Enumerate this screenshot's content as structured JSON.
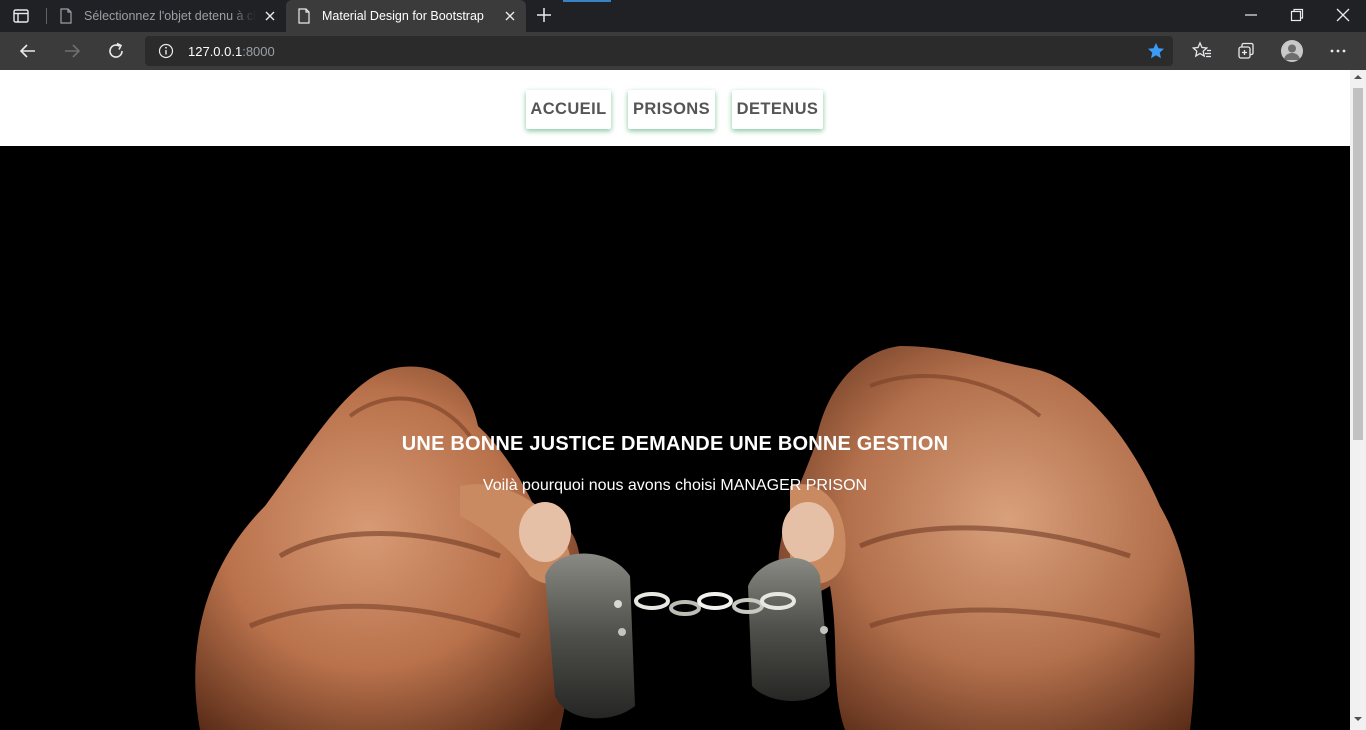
{
  "browser": {
    "tabs": [
      {
        "title": "Sélectionnez l'objet detenu à changer",
        "active": false
      },
      {
        "title": "Material Design for Bootstrap",
        "active": true
      }
    ],
    "url_host": "127.0.0.1",
    "url_port": ":8000",
    "icons": [
      "tab-actions-icon",
      "page-icon",
      "close-icon",
      "plus-icon",
      "minimize-icon",
      "restore-icon",
      "window-close-icon",
      "back-icon",
      "forward-icon",
      "refresh-icon",
      "info-icon",
      "star-icon",
      "favorites-icon",
      "collections-icon",
      "profile-icon",
      "more-icon"
    ],
    "colors": {
      "tabstrip": "#202124",
      "toolbar": "#3b3b3b",
      "accent": "#3b82c4"
    }
  },
  "site": {
    "nav": [
      {
        "label": "ACCUEIL"
      },
      {
        "label": "PRISONS"
      },
      {
        "label": "DETENUS"
      }
    ],
    "hero": {
      "title": "UNE BONNE JUSTICE DEMANDE UNE BONNE GESTION",
      "subtitle": "Voilà pourquoi nous avons choisi MANAGER PRISON"
    },
    "colors": {
      "nav_text": "#555555",
      "nav_glow": "#00c851",
      "hero_bg": "#000000"
    }
  }
}
